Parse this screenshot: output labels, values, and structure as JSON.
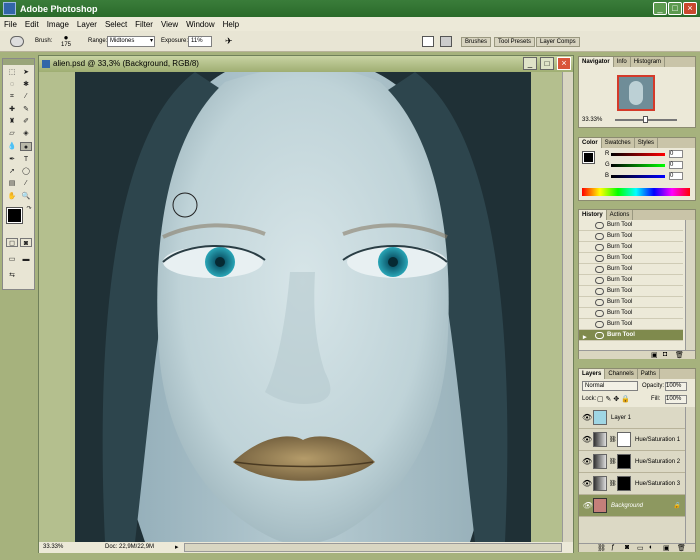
{
  "app": {
    "title": "Adobe Photoshop"
  },
  "menu": [
    "File",
    "Edit",
    "Image",
    "Layer",
    "Select",
    "Filter",
    "View",
    "Window",
    "Help"
  ],
  "options": {
    "brush_label": "Brush:",
    "brush_size": "175",
    "range_label": "Range:",
    "range_value": "Midtones",
    "exposure_label": "Exposure:",
    "exposure_value": "11%",
    "palette_tabs": [
      "Brushes",
      "Tool Presets",
      "Layer Comps"
    ]
  },
  "document": {
    "title": "alien.psd @ 33,3% (Background, RGB/8)",
    "zoom": "33.33%",
    "doc_info": "Doc: 22,9M/22,9M"
  },
  "navigator": {
    "tabs": [
      "Navigator",
      "Info",
      "Histogram"
    ],
    "zoom": "33.33%"
  },
  "color": {
    "tabs": [
      "Color",
      "Swatches",
      "Styles"
    ],
    "channels": [
      {
        "name": "R",
        "value": "0"
      },
      {
        "name": "G",
        "value": "0"
      },
      {
        "name": "B",
        "value": "0"
      }
    ]
  },
  "history": {
    "tabs": [
      "History",
      "Actions"
    ],
    "items": [
      "Burn Tool",
      "Burn Tool",
      "Burn Tool",
      "Burn Tool",
      "Burn Tool",
      "Burn Tool",
      "Burn Tool",
      "Burn Tool",
      "Burn Tool",
      "Burn Tool",
      "Burn Tool"
    ]
  },
  "layers": {
    "tabs": [
      "Layers",
      "Channels",
      "Paths"
    ],
    "blend_mode": "Normal",
    "opacity_label": "Opacity:",
    "opacity": "100%",
    "lock_label": "Lock:",
    "fill_label": "Fill:",
    "fill": "100%",
    "items": [
      "Layer 1",
      "Hue/Saturation 1",
      "Hue/Saturation 2",
      "Hue/Saturation 3",
      "Background"
    ]
  },
  "colors": {
    "title_bar": "#2f7530",
    "workspace": "#a6b27d",
    "accent": "#7f8a4d"
  }
}
